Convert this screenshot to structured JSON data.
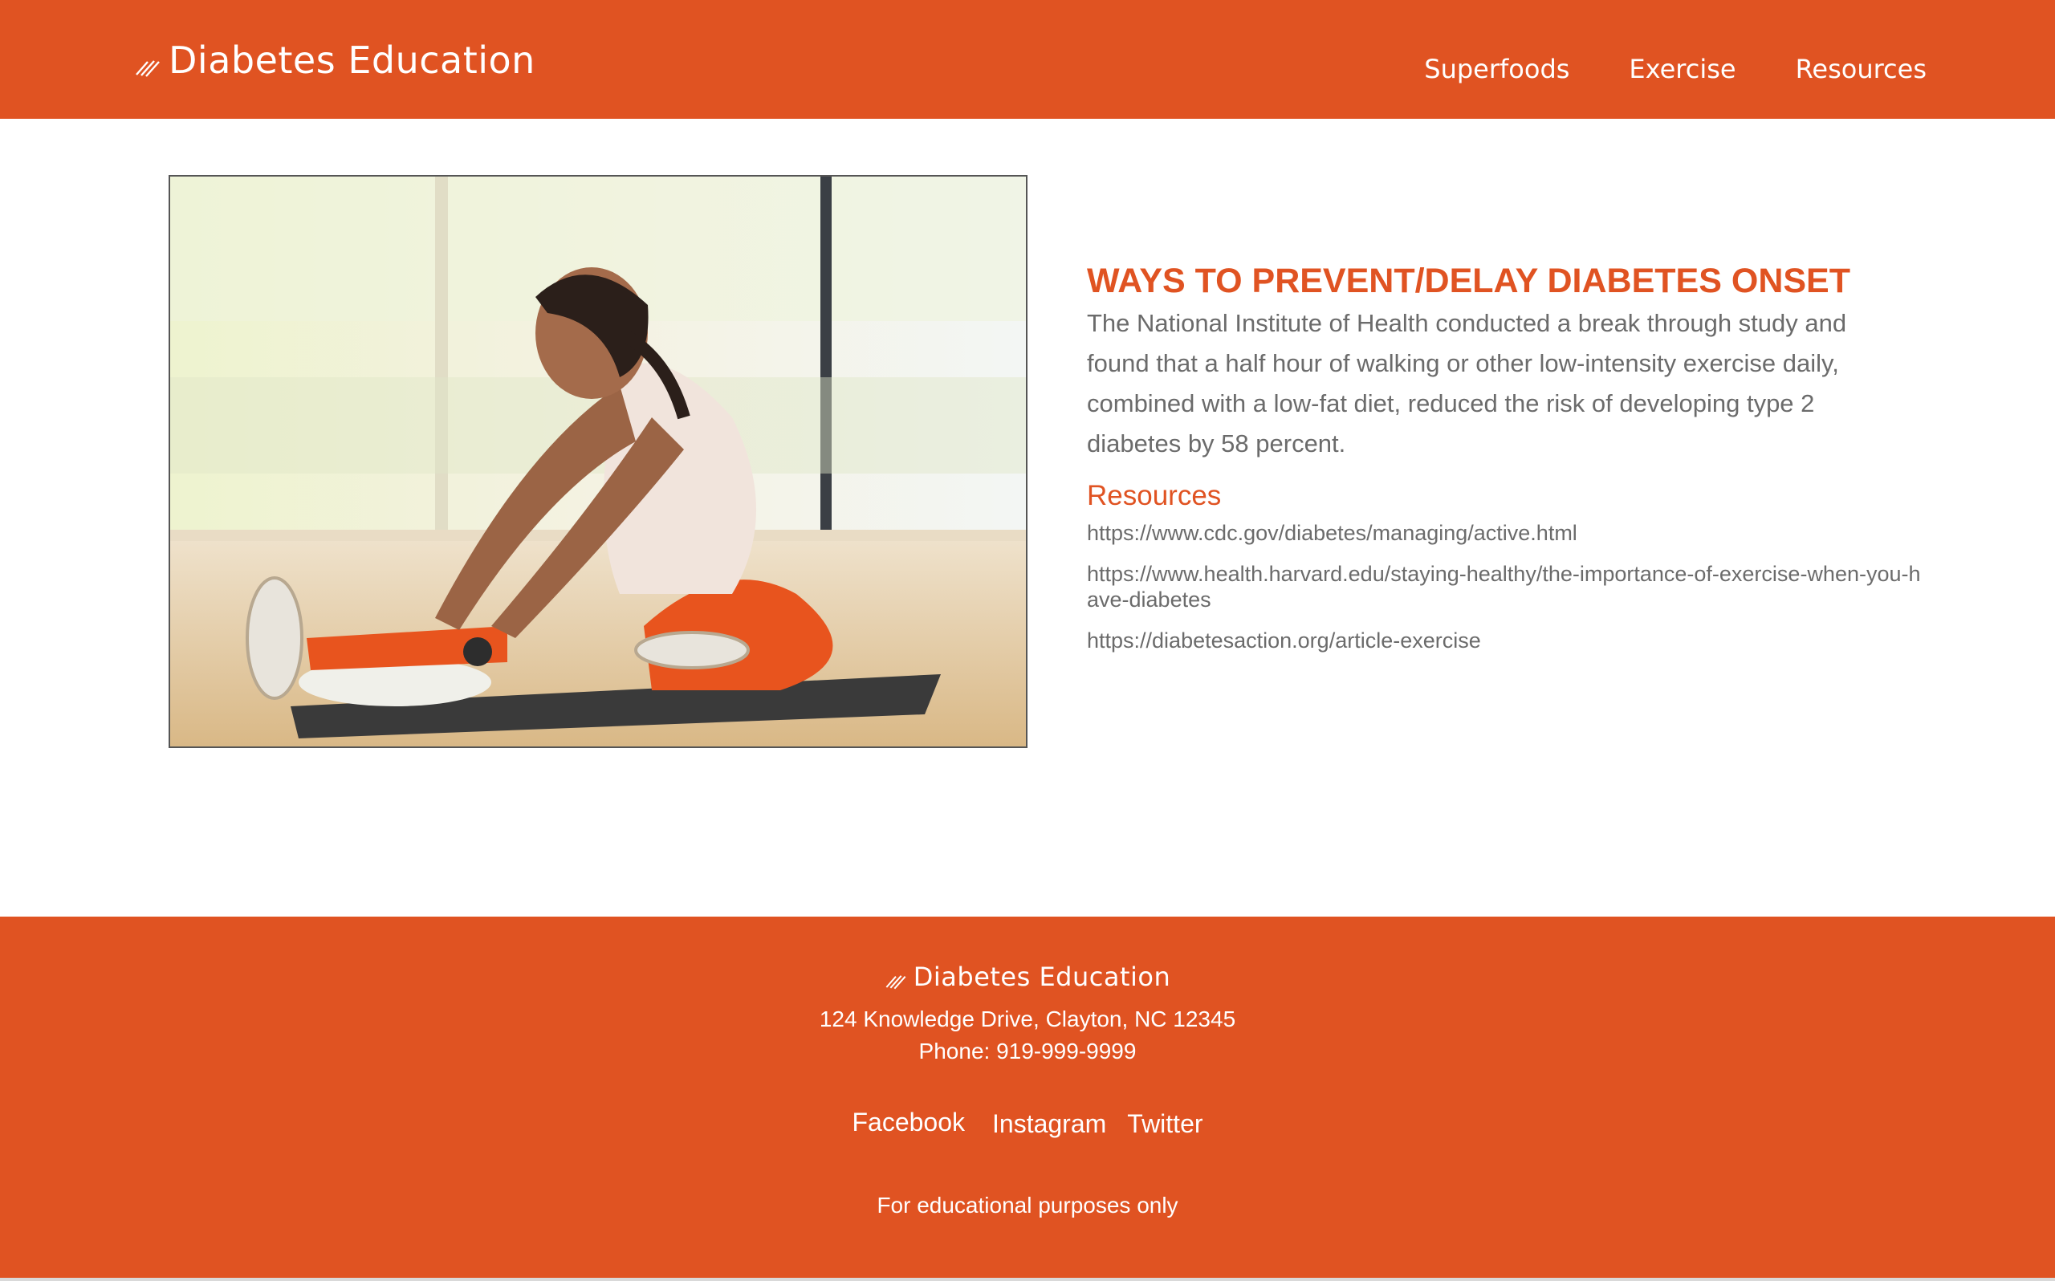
{
  "header": {
    "brand": "Diabetes Education",
    "nav": [
      "Superfoods",
      "Exercise",
      "Resources"
    ]
  },
  "main": {
    "image_alt": "Woman stretching on a yoga mat",
    "heading": "WAYS TO PREVENT/DELAY DIABETES ONSET",
    "intro": "The National Institute of Health conducted a break through study and found that a half hour of walking or other low-intensity exercise daily, combined with a low-fat diet, reduced the risk of developing type 2 diabetes by 58 percent.",
    "resources_heading": "Resources",
    "resources": [
      "https://www.cdc.gov/diabetes/managing/active.html",
      "https://www.health.harvard.edu/staying-healthy/the-importance-of-exercise-when-you-have-diabetes",
      "https://diabetesaction.org/article-exercise"
    ]
  },
  "footer": {
    "brand": "Diabetes Education",
    "address": "124 Knowledge Drive, Clayton, NC 12345",
    "phone": "Phone: 919-999-9999",
    "social": [
      "Facebook",
      "Instagram",
      "Twitter"
    ],
    "note": "For educational purposes only"
  },
  "colors": {
    "accent": "#e05322",
    "body_text": "#6b6b6b",
    "background": "#ffffff"
  },
  "icons": {
    "brand": "diagonal-lines-icon"
  }
}
